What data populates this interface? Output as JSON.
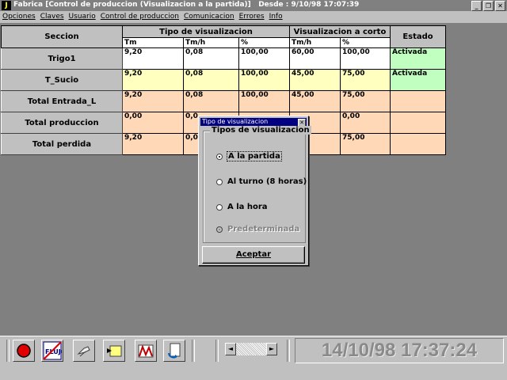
{
  "window": {
    "app_icon": "J",
    "title": "Fabrica [Control de produccion (Visualizacion a la partida)]",
    "desde": "Desde :  9/10/98 17:07:39",
    "buttons": [
      "minimize-icon",
      "restore-icon",
      "close-icon"
    ]
  },
  "menu": [
    "Opciones",
    "Claves",
    "Usuario",
    "Control de produccion",
    "Comunicacion",
    "Errores",
    "Info"
  ],
  "table": {
    "headers": {
      "seccion": "Seccion",
      "tipo": "Tipo de visualizacion",
      "corto": "Visualizacion a corto",
      "estado": "Estado"
    },
    "subheaders": [
      "Tm",
      "Tm/h",
      "%",
      "Tm/h",
      "%"
    ],
    "rows": [
      {
        "label": "Trigo1",
        "values": [
          "9,20",
          "0,08",
          "100,00",
          "60,00",
          "100,00"
        ],
        "estado": "Activada"
      },
      {
        "label": "T_Sucio",
        "values": [
          "9,20",
          "0,08",
          "100,00",
          "45,00",
          "75,00"
        ],
        "estado": "Activada"
      },
      {
        "label": "Total Entrada_L",
        "values": [
          "9,20",
          "0,08",
          "100,00",
          "45,00",
          "75,00"
        ],
        "estado": ""
      },
      {
        "label": "Total produccion",
        "values": [
          "0,00",
          "0,0",
          "",
          "",
          "0,00"
        ],
        "estado": ""
      },
      {
        "label": "Total perdida",
        "values": [
          "9,20",
          "0,0",
          "",
          "0",
          "75,00"
        ],
        "estado": ""
      }
    ],
    "colors": {
      "white": "#ffffff",
      "yellow": "#ffffc0",
      "orange": "#ffd8b8",
      "green": "#c0ffc0"
    }
  },
  "dialog": {
    "title": "Tipo de visualizacion",
    "group_label": "Tipos de visualizacion",
    "options": [
      {
        "label": "A la partida",
        "selected": true,
        "enabled": true
      },
      {
        "label": "Al turno (8 horas)",
        "selected": false,
        "enabled": true
      },
      {
        "label": "A la hora",
        "selected": false,
        "enabled": true
      },
      {
        "label": "Predeterminada",
        "selected": false,
        "enabled": false
      }
    ],
    "accept_label": "Aceptar"
  },
  "taskbar": {
    "buttons": [
      "stop-icon",
      "flujo-icon",
      "keys-icon",
      "pointer-icon",
      "bars-icon",
      "refresh-icon"
    ],
    "scroll_left": "◄",
    "scroll_right": "►",
    "clock": "14/10/98 17:37:24"
  }
}
